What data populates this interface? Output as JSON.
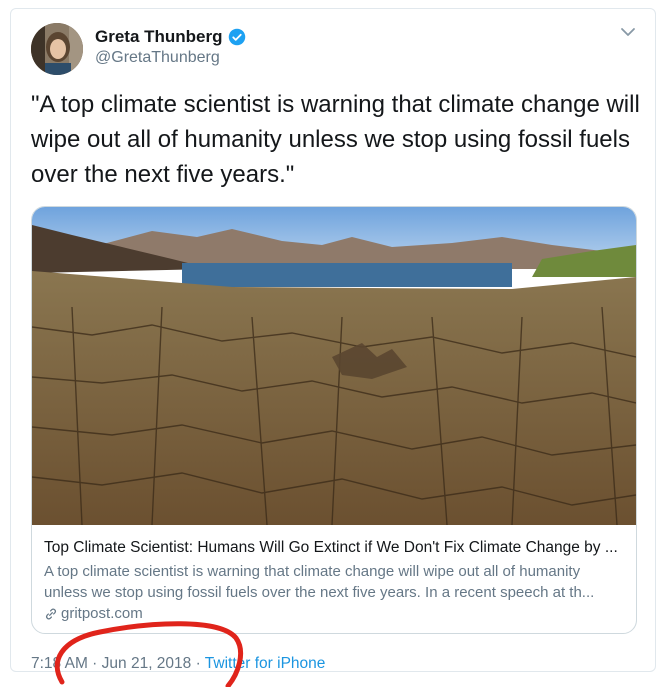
{
  "user": {
    "display_name": "Greta Thunberg",
    "handle": "@GretaThunberg"
  },
  "tweet": {
    "text": "\"A top climate scientist is warning that climate change will wipe out all of humanity unless we stop using fossil fuels over the next five years.\""
  },
  "link_card": {
    "title": "Top Climate Scientist: Humans Will Go Extinct if We Don't Fix Climate Change by ...",
    "description": "A top climate scientist is warning that climate change will wipe out all of humanity unless we stop using fossil fuels over the next five years. In a recent speech at th...",
    "domain": "gritpost.com"
  },
  "meta": {
    "time": "7:18 AM",
    "separator1": " · ",
    "date": "Jun 21, 2018",
    "separator2": " · ",
    "source": "Twitter for iPhone"
  },
  "icons": {
    "verified": "verified-badge-icon",
    "chevron": "chevron-down-icon",
    "link": "link-icon"
  },
  "colors": {
    "link_blue": "#1b95e0",
    "verified_blue": "#1da1f2",
    "secondary_text": "#657786",
    "annotation_red": "#e0241b"
  }
}
